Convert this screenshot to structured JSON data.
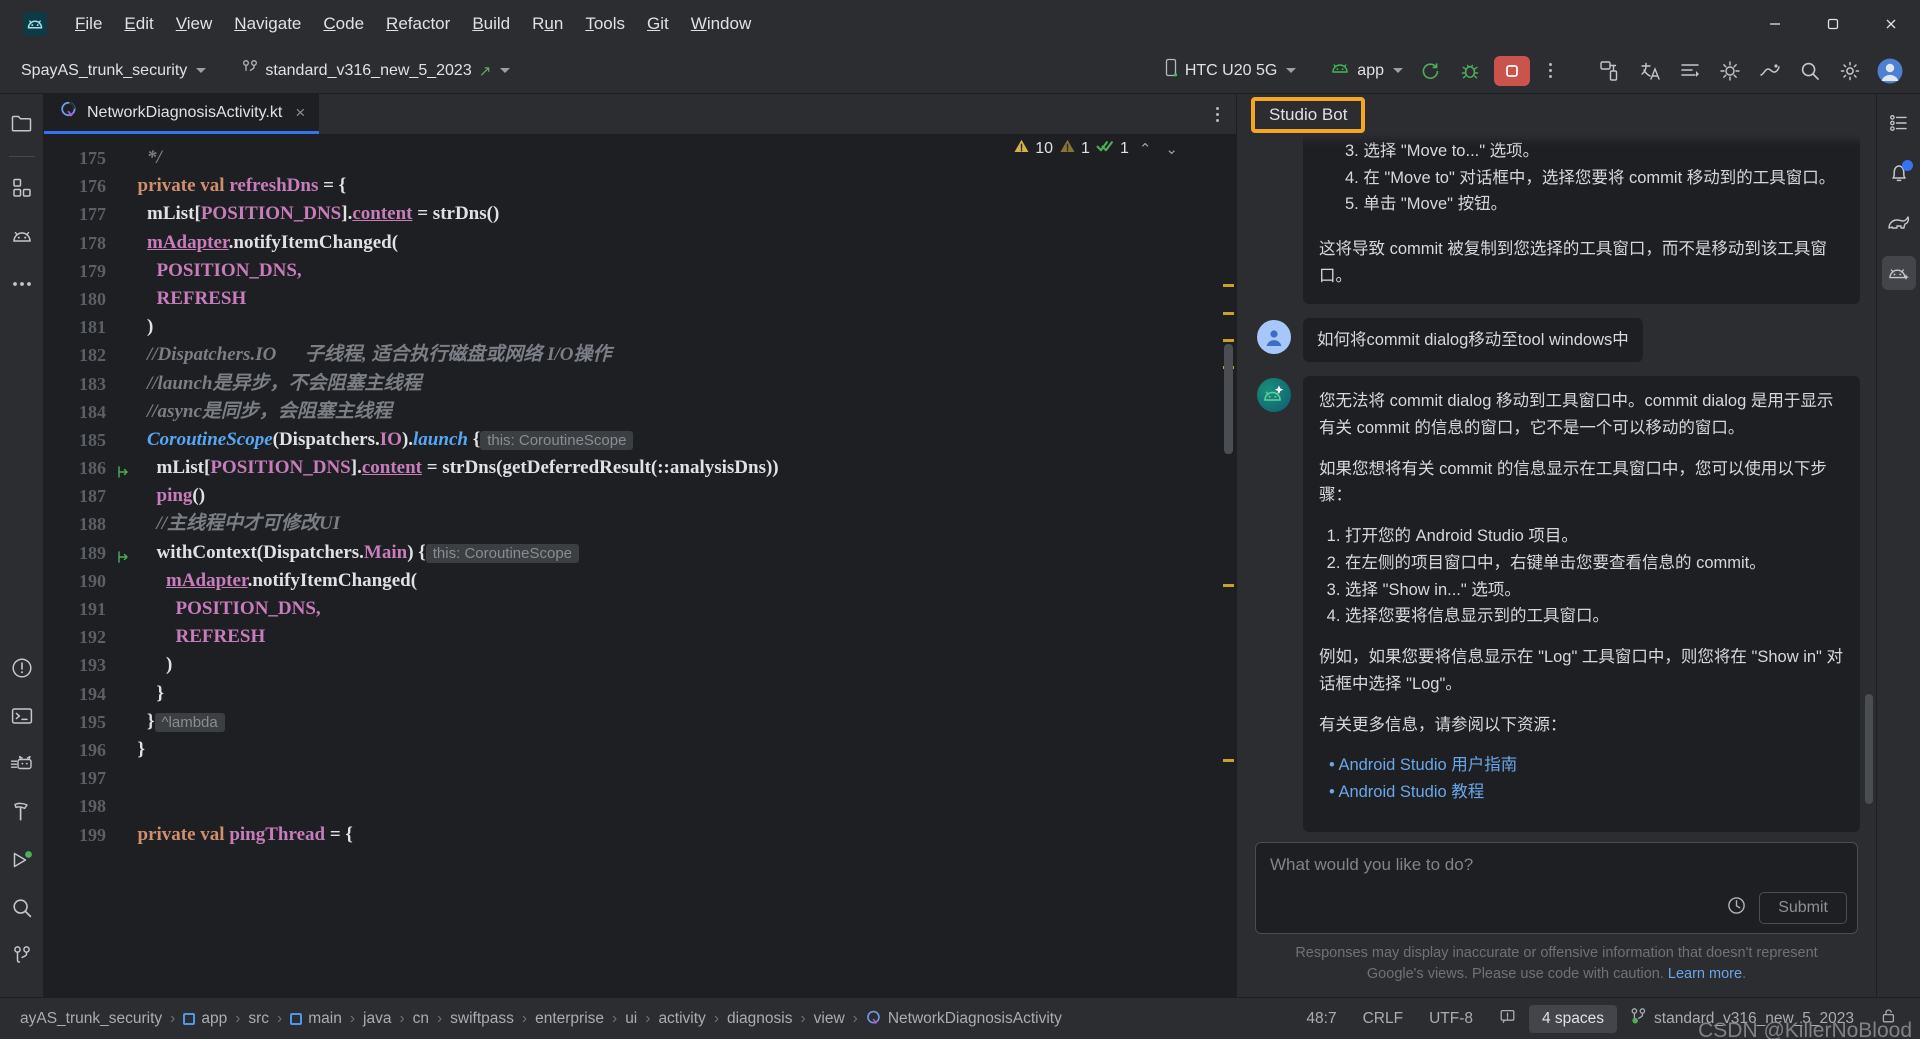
{
  "app": {
    "logo_icon": "android-logo-icon",
    "menu": [
      {
        "label": "File",
        "mnemonic": "F"
      },
      {
        "label": "Edit",
        "mnemonic": "E"
      },
      {
        "label": "View",
        "mnemonic": "V"
      },
      {
        "label": "Navigate",
        "mnemonic": "N"
      },
      {
        "label": "Code",
        "mnemonic": "C"
      },
      {
        "label": "Refactor",
        "mnemonic": "R"
      },
      {
        "label": "Build",
        "mnemonic": "B"
      },
      {
        "label": "Run",
        "mnemonic": "u"
      },
      {
        "label": "Tools",
        "mnemonic": "T"
      },
      {
        "label": "Git",
        "mnemonic": "G"
      },
      {
        "label": "Window",
        "mnemonic": "W"
      }
    ],
    "window_controls": [
      "minimize",
      "maximize",
      "close"
    ]
  },
  "toolbar": {
    "project_name": "SpayAS_trunk_security",
    "branch_name": "standard_v316_new_5_2023",
    "device": "HTC U20 5G",
    "run_config": "app",
    "icons": [
      "sync-icon",
      "debug-icon",
      "stop-icon",
      "more-icon",
      "device-manager-icon",
      "translate-icon",
      "layout-inspector-icon",
      "profiler-icon",
      "logcat-icon",
      "search-icon",
      "settings-icon",
      "account-icon"
    ]
  },
  "left_sidebar": {
    "items": [
      {
        "name": "project-icon",
        "label": "Project"
      },
      {
        "name": "structure-icon",
        "label": "Structure"
      },
      {
        "name": "android-resource-icon",
        "label": "Resource Manager"
      },
      {
        "name": "more-tool-windows-icon",
        "label": "More tool windows"
      }
    ],
    "bottom_items": [
      {
        "name": "problems-icon",
        "label": "Problems"
      },
      {
        "name": "terminal-icon",
        "label": "Terminal"
      },
      {
        "name": "logcat-icon",
        "label": "Logcat"
      },
      {
        "name": "build-icon",
        "label": "Build"
      },
      {
        "name": "run-icon",
        "label": "Run"
      },
      {
        "name": "find-icon",
        "label": "Find"
      },
      {
        "name": "git-icon",
        "label": "Git"
      }
    ]
  },
  "right_sidebar": {
    "items": [
      {
        "name": "notifications-list-icon",
        "label": "Notifications"
      },
      {
        "name": "bell-icon",
        "label": "Events",
        "badge": true
      },
      {
        "name": "gradle-icon",
        "label": "Gradle"
      },
      {
        "name": "studio-bot-icon",
        "label": "Studio Bot",
        "active": true
      }
    ]
  },
  "editor": {
    "tab": {
      "filename": "NetworkDiagnosisActivity.kt",
      "icon": "kotlin-class-icon",
      "close": "×"
    },
    "inspections": {
      "warnings": "10",
      "weak_warnings": "1",
      "checks": "1",
      "up": "⌃",
      "down": "⌄"
    },
    "first_line": 175,
    "lines": [
      {
        "n": 175,
        "tokens": [
          {
            "t": "    ",
            "c": "k-plain"
          },
          {
            "t": "*/",
            "c": "k-cmt"
          }
        ]
      },
      {
        "n": 176,
        "tokens": [
          {
            "t": "  ",
            "c": "k-plain"
          },
          {
            "t": "private val ",
            "c": "k-kw"
          },
          {
            "t": "refreshDns",
            "c": "k-prop"
          },
          {
            "t": " = {",
            "c": "k-plain"
          }
        ]
      },
      {
        "n": 177,
        "tokens": [
          {
            "t": "    ",
            "c": "k-plain"
          },
          {
            "t": "mList",
            "c": "k-plain"
          },
          {
            "t": "[",
            "c": "k-plain"
          },
          {
            "t": "POSITION_DNS",
            "c": "k-prop"
          },
          {
            "t": "].",
            "c": "k-plain"
          },
          {
            "t": "content",
            "c": "k-under"
          },
          {
            "t": " = strDns()",
            "c": "k-plain"
          }
        ]
      },
      {
        "n": 178,
        "tokens": [
          {
            "t": "    ",
            "c": "k-plain"
          },
          {
            "t": "mAdapter",
            "c": "k-under"
          },
          {
            "t": ".notifyItemChanged(",
            "c": "k-plain"
          }
        ]
      },
      {
        "n": 179,
        "tokens": [
          {
            "t": "      ",
            "c": "k-plain"
          },
          {
            "t": "POSITION_DNS,",
            "c": "k-prop"
          }
        ]
      },
      {
        "n": 180,
        "tokens": [
          {
            "t": "      ",
            "c": "k-plain"
          },
          {
            "t": "REFRESH",
            "c": "k-prop"
          }
        ]
      },
      {
        "n": 181,
        "tokens": [
          {
            "t": "    )",
            "c": "k-plain"
          }
        ]
      },
      {
        "n": 182,
        "tokens": [
          {
            "t": "    ",
            "c": "k-plain"
          },
          {
            "t": "//Dispatchers.IO      子线程, 适合执行磁盘或网络 I/O操作",
            "c": "k-cmt"
          }
        ]
      },
      {
        "n": 183,
        "tokens": [
          {
            "t": "    ",
            "c": "k-plain"
          },
          {
            "t": "//launch是异步，不会阻塞主线程",
            "c": "k-cmt"
          }
        ]
      },
      {
        "n": 184,
        "tokens": [
          {
            "t": "    ",
            "c": "k-plain"
          },
          {
            "t": "//async是同步，会阻塞主线程",
            "c": "k-cmt"
          }
        ]
      },
      {
        "n": 185,
        "tokens": [
          {
            "t": "    ",
            "c": "k-plain"
          },
          {
            "t": "CoroutineScope",
            "c": "k-blue"
          },
          {
            "t": "(Dispatchers.",
            "c": "k-plain"
          },
          {
            "t": "IO",
            "c": "k-prop"
          },
          {
            "t": ").",
            "c": "k-plain"
          },
          {
            "t": "launch",
            "c": "k-blue"
          },
          {
            "t": " {",
            "c": "k-plain"
          },
          {
            "t": "this: CoroutineScope",
            "c": "hint"
          }
        ]
      },
      {
        "n": 186,
        "marker": "branch",
        "tokens": [
          {
            "t": "      ",
            "c": "k-plain"
          },
          {
            "t": "mList",
            "c": "k-plain"
          },
          {
            "t": "[",
            "c": "k-plain"
          },
          {
            "t": "POSITION_DNS",
            "c": "k-prop"
          },
          {
            "t": "].",
            "c": "k-plain"
          },
          {
            "t": "content",
            "c": "k-under"
          },
          {
            "t": " = strDns(getDeferredResult(::analysisDns))",
            "c": "k-plain"
          }
        ]
      },
      {
        "n": 187,
        "tokens": [
          {
            "t": "      ",
            "c": "k-plain"
          },
          {
            "t": "ping",
            "c": "k-prop"
          },
          {
            "t": "()",
            "c": "k-plain"
          }
        ]
      },
      {
        "n": 188,
        "tokens": [
          {
            "t": "      ",
            "c": "k-plain"
          },
          {
            "t": "//主线程中才可修改UI",
            "c": "k-cmt"
          }
        ]
      },
      {
        "n": 189,
        "marker": "branch",
        "tokens": [
          {
            "t": "      ",
            "c": "k-plain"
          },
          {
            "t": "withContext(Dispatchers.",
            "c": "k-plain"
          },
          {
            "t": "Main",
            "c": "k-prop"
          },
          {
            "t": ") {",
            "c": "k-plain"
          },
          {
            "t": "this: CoroutineScope",
            "c": "hint"
          }
        ]
      },
      {
        "n": 190,
        "tokens": [
          {
            "t": "        ",
            "c": "k-plain"
          },
          {
            "t": "mAdapter",
            "c": "k-under"
          },
          {
            "t": ".notifyItemChanged(",
            "c": "k-plain"
          }
        ]
      },
      {
        "n": 191,
        "tokens": [
          {
            "t": "          ",
            "c": "k-plain"
          },
          {
            "t": "POSITION_DNS,",
            "c": "k-prop"
          }
        ]
      },
      {
        "n": 192,
        "tokens": [
          {
            "t": "          ",
            "c": "k-plain"
          },
          {
            "t": "REFRESH",
            "c": "k-prop"
          }
        ]
      },
      {
        "n": 193,
        "tokens": [
          {
            "t": "        )",
            "c": "k-plain"
          }
        ]
      },
      {
        "n": 194,
        "tokens": [
          {
            "t": "      }",
            "c": "k-plain"
          }
        ]
      },
      {
        "n": 195,
        "tokens": [
          {
            "t": "    }",
            "c": "k-plain"
          },
          {
            "t": "^lambda",
            "c": "hint"
          }
        ]
      },
      {
        "n": 196,
        "tokens": [
          {
            "t": "  }",
            "c": "k-plain"
          }
        ]
      },
      {
        "n": 197,
        "tokens": [
          {
            "t": "",
            "c": "k-plain"
          }
        ]
      },
      {
        "n": 198,
        "tokens": [
          {
            "t": "",
            "c": "k-plain"
          }
        ]
      },
      {
        "n": 199,
        "tokens": [
          {
            "t": "  ",
            "c": "k-plain"
          },
          {
            "t": "private val ",
            "c": "k-kw"
          },
          {
            "t": "pingThread",
            "c": "k-prop"
          },
          {
            "t": " = {",
            "c": "k-plain"
          }
        ]
      }
    ]
  },
  "studio_bot": {
    "title": "Studio Bot",
    "title_highlight_color": "#f5a623",
    "first_partial_message": {
      "list": [
        "3. 选择 \"Move to...\" 选项。",
        "4. 在 \"Move to\" 对话框中，选择您要将 commit 移动到的工具窗口。",
        "5. 单击 \"Move\" 按钮。"
      ],
      "paragraph": "这将导致 commit 被复制到您选择的工具窗口，而不是移动到该工具窗口。"
    },
    "messages": [
      {
        "role": "user",
        "avatar": "user-avatar-icon",
        "text": "如何将commit dialog移动至tool windows中"
      },
      {
        "role": "bot",
        "avatar": "studio-bot-avatar-icon",
        "paragraphs": [
          "您无法将 commit dialog 移动到工具窗口中。commit dialog 是用于显示有关 commit 的信息的窗口，它不是一个可以移动的窗口。",
          "如果您想将有关 commit 的信息显示在工具窗口中，您可以使用以下步骤："
        ],
        "steps": [
          "打开您的 Android Studio 项目。",
          "在左侧的项目窗口中，右键单击您要查看信息的 commit。",
          "选择 \"Show in...\" 选项。",
          "选择您要将信息显示到的工具窗口。"
        ],
        "paragraph_after": "例如，如果您要将信息显示在 \"Log\" 工具窗口中，则您将在 \"Show in\" 对话框中选择 \"Log\"。",
        "resources_intro": "有关更多信息，请参阅以下资源：",
        "resources": [
          "Android Studio 用户指南",
          "Android Studio 教程"
        ]
      }
    ],
    "input": {
      "placeholder": "What would you like to do?",
      "history_icon": "clock-history-icon",
      "submit_label": "Submit"
    },
    "disclaimer": "Responses may display inaccurate or offensive information that doesn't represent Google's views. Please use code with caution.",
    "disclaimer_link": "Learn more",
    "disclaimer_period": "."
  },
  "statusbar": {
    "breadcrumbs": [
      {
        "label": "ayAS_trunk_security",
        "icon": null
      },
      {
        "label": "app",
        "icon": "module-icon"
      },
      {
        "label": "src",
        "icon": null
      },
      {
        "label": "main",
        "icon": "module-icon"
      },
      {
        "label": "java",
        "icon": null
      },
      {
        "label": "cn",
        "icon": null
      },
      {
        "label": "swiftpass",
        "icon": null
      },
      {
        "label": "enterprise",
        "icon": null
      },
      {
        "label": "ui",
        "icon": null
      },
      {
        "label": "activity",
        "icon": null
      },
      {
        "label": "diagnosis",
        "icon": null
      },
      {
        "label": "view",
        "icon": null
      },
      {
        "label": "NetworkDiagnosisActivity",
        "icon": "kotlin-class-icon"
      }
    ],
    "separator": "›",
    "caret_position": "48:7",
    "line_separator": "CRLF",
    "encoding": "UTF-8",
    "read_only_icon": "lock-indicator-icon",
    "indent": "4 spaces",
    "branch": "standard_v316_new_5_2023",
    "branch_icon": "git-branch-icon",
    "lock_icon": "lock-icon"
  },
  "watermark": "CSDN @KillerNoBlood"
}
